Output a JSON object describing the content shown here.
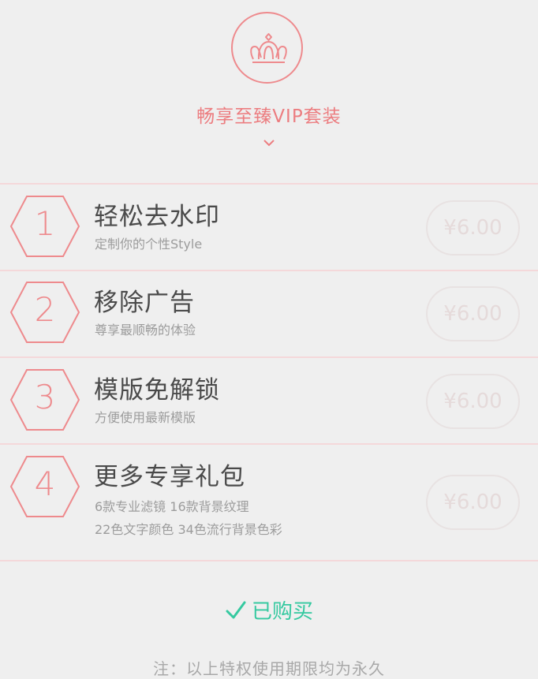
{
  "header": {
    "title": "畅享至臻VIP套装",
    "crown_icon": "crown-icon",
    "expand_icon": "chevron-down-icon"
  },
  "colors": {
    "accent": "#ee8a8d",
    "success": "#35c9a0",
    "divider": "#f4d8da",
    "background": "#efefef"
  },
  "items": [
    {
      "number": "1",
      "title": "轻松去水印",
      "subtitles": [
        "定制你的个性Style"
      ],
      "price": "¥6.00"
    },
    {
      "number": "2",
      "title": "移除广告",
      "subtitles": [
        "尊享最顺畅的体验"
      ],
      "price": "¥6.00"
    },
    {
      "number": "3",
      "title": "模版免解锁",
      "subtitles": [
        "方便使用最新模版"
      ],
      "price": "¥6.00"
    },
    {
      "number": "4",
      "title": "更多专享礼包",
      "subtitles": [
        "6款专业滤镜 16款背景纹理",
        "22色文字颜色 34色流行背景色彩"
      ],
      "price": "¥6.00"
    }
  ],
  "status": {
    "icon": "checkmark-icon",
    "label": "已购买"
  },
  "footer": {
    "note": "注：以上特权使用期限均为永久"
  }
}
